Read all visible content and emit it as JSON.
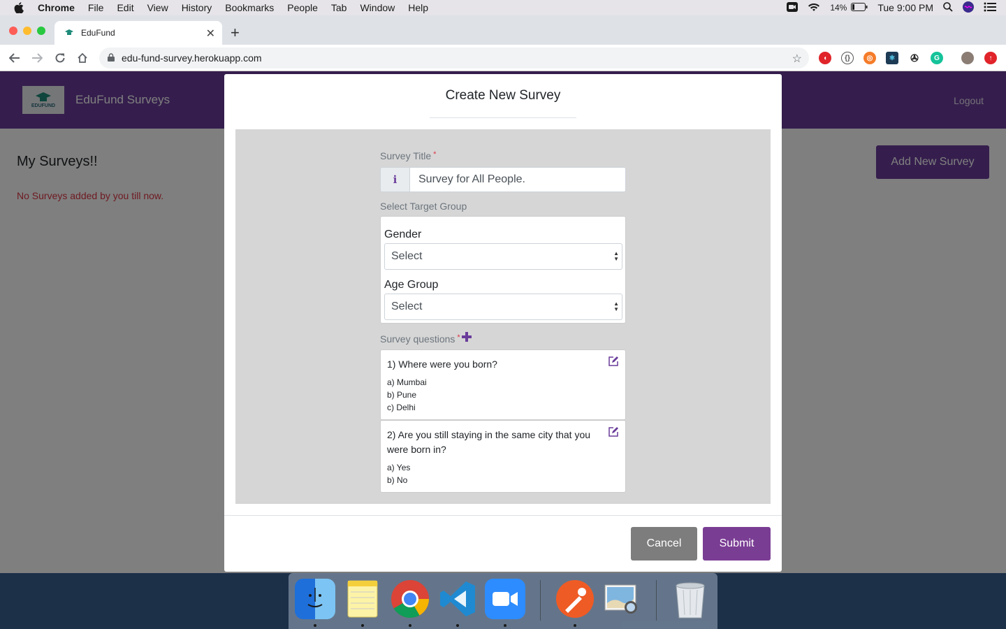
{
  "menubar": {
    "app": "Chrome",
    "items": [
      "File",
      "Edit",
      "View",
      "History",
      "Bookmarks",
      "People",
      "Tab",
      "Window",
      "Help"
    ],
    "battery": "14%",
    "clock": "Tue 9:00 PM"
  },
  "browser": {
    "tab_title": "EduFund",
    "url": "edu-fund-survey.herokuapp.com"
  },
  "app": {
    "logo_text": "EDUFUND",
    "brand": "EduFund Surveys",
    "logout": "Logout",
    "page_heading": "My Surveys!!",
    "empty_message": "No Surveys added by you till now.",
    "add_button": "Add New Survey",
    "brand_color": "#6a3c9a"
  },
  "modal": {
    "title": "Create New Survey",
    "survey_title_label": "Survey Title",
    "survey_title_value": "Survey for All People.",
    "required_mark": "*",
    "info_icon": "i",
    "target_group_label": "Select Target Group",
    "gender_label": "Gender",
    "gender_value": "Select",
    "age_label": "Age Group",
    "age_value": "Select",
    "questions_label": "Survey questions",
    "questions": [
      {
        "text": "1) Where were you born?",
        "options": [
          "a) Mumbai",
          "b) Pune",
          "c) Delhi"
        ]
      },
      {
        "text": "2) Are you still staying in the same city that you were born in?",
        "options": [
          "a) Yes",
          "b) No"
        ]
      }
    ],
    "cancel": "Cancel",
    "submit": "Submit"
  },
  "dock": {
    "apps": [
      "finder",
      "notes",
      "chrome",
      "vscode",
      "zoom",
      "postman",
      "preview",
      "trash"
    ]
  }
}
